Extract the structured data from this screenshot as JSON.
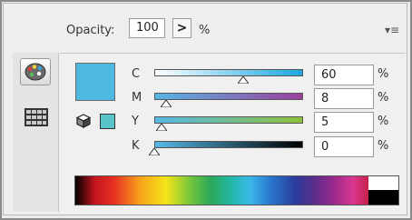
{
  "header": {
    "opacity_label": "Opacity:",
    "opacity_value": "100",
    "opacity_arrow": ">",
    "opacity_unit": "%",
    "menu_icon": "panel-menu-icon"
  },
  "sidebar": {
    "tabs": [
      {
        "name": "color-palette-icon",
        "selected": true
      },
      {
        "name": "swatches-grid-icon",
        "selected": false
      }
    ]
  },
  "color": {
    "fill_hex": "#4fb8e0",
    "web_safe_hex": "#56c4c9"
  },
  "channels": [
    {
      "label": "C",
      "value": "60",
      "unit": "%",
      "level": 0.6,
      "gradient": [
        "#ffffff",
        "#1aa6e0"
      ]
    },
    {
      "label": "M",
      "value": "8",
      "unit": "%",
      "level": 0.08,
      "gradient": [
        "#56b8e6",
        "#9c3f9c"
      ]
    },
    {
      "label": "Y",
      "value": "5",
      "unit": "%",
      "level": 0.05,
      "gradient": [
        "#56b8e6",
        "#8ec23c"
      ]
    },
    {
      "label": "K",
      "value": "0",
      "unit": "%",
      "level": 0.0,
      "gradient": [
        "#56b8e6",
        "#000000"
      ]
    }
  ]
}
